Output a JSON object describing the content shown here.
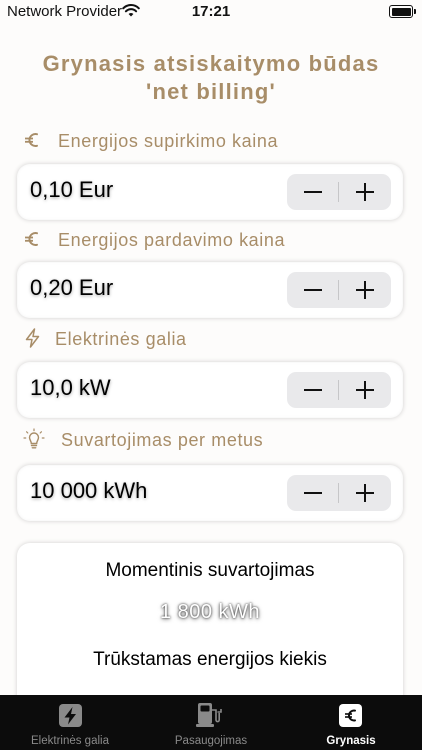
{
  "status_bar": {
    "carrier": "Network Provider",
    "time": "17:21"
  },
  "title": {
    "line1": "Grynasis atsiskaitymo būdas",
    "line2": "'net billing'"
  },
  "fields": [
    {
      "label": "Energijos supirkimo kaina",
      "icon": "euro-icon",
      "value": "0,10 Eur"
    },
    {
      "label": "Energijos pardavimo kaina",
      "icon": "euro-icon",
      "value": "0,20 Eur"
    },
    {
      "label": "Elektrinės galia",
      "icon": "bolt-icon",
      "value": "10,0 kW"
    },
    {
      "label": "Suvartojimas per metus",
      "icon": "lightbulb-icon",
      "value": "10 000 kWh"
    }
  ],
  "result": {
    "heading1": "Momentinis suvartojimas",
    "value1": "1 800 kWh",
    "heading2": "Trūkstamas energijos kiekis"
  },
  "tabs": [
    {
      "label": "Elektrinės galia",
      "icon": "bolt-square-icon",
      "active": false
    },
    {
      "label": "Pasaugojimas",
      "icon": "fuel-pump-icon",
      "active": false
    },
    {
      "label": "Grynasis",
      "icon": "euro-square-icon",
      "active": true
    }
  ],
  "colors": {
    "accent": "#a88d68",
    "tabbar_bg": "#0c0c0c",
    "stepper_bg": "#e9e9eb"
  }
}
